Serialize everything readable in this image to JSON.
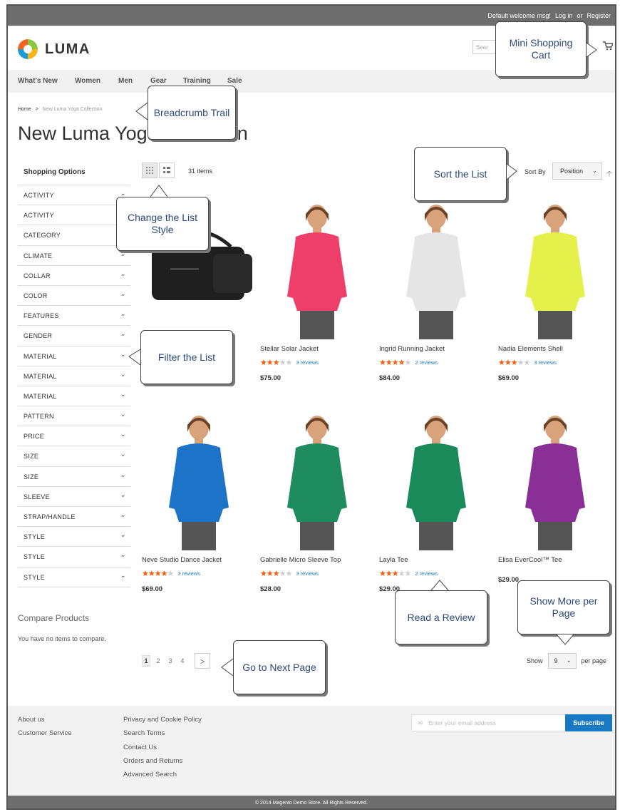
{
  "topbar": {
    "welcome": "Default welcome msg!",
    "login": "Log in",
    "or": "or",
    "register": "Register"
  },
  "header": {
    "logo_text": "LUMA",
    "search_placeholder": "Sear",
    "cart_icon": "cart-icon"
  },
  "nav": [
    "What's New",
    "Women",
    "Men",
    "Gear",
    "Training",
    "Sale"
  ],
  "breadcrumb": {
    "home": "Home",
    "separator": ">",
    "current": "New Luma Yoga Collection"
  },
  "page_title": "New Luma Yoga Collection",
  "sidebar": {
    "title": "Shopping Options",
    "filters": [
      "ACTIVITY",
      "ACTIVITY",
      "CATEGORY",
      "CLIMATE",
      "COLLAR",
      "COLOR",
      "FEATURES",
      "GENDER",
      "MATERIAL",
      "MATERIAL",
      "MATERIAL",
      "PATTERN",
      "PRICE",
      "SIZE",
      "SIZE",
      "SLEEVE",
      "STRAP/HANDLE",
      "STYLE",
      "STYLE",
      "STYLE"
    ]
  },
  "compare": {
    "title": "Compare Products",
    "text": "You have no items to compare."
  },
  "toolbar": {
    "item_count": "31 items",
    "sort_label": "Sort By",
    "sort_value": "Position"
  },
  "products": [
    {
      "name": "",
      "rating": 0,
      "reviews": "",
      "price": "",
      "color": "#1f1f1f"
    },
    {
      "name": "Stellar Solar Jacket",
      "rating": 3.5,
      "reviews": "3 reviews",
      "price": "$75.00",
      "color": "#ee3f6a"
    },
    {
      "name": "Ingrid Running Jacket",
      "rating": 4.5,
      "reviews": "2 reviews",
      "price": "$84.00",
      "color": "#e5e5e5"
    },
    {
      "name": "Nadia Elements Shell",
      "rating": 3,
      "reviews": "3 reviews",
      "price": "$69.00",
      "color": "#e4f14a"
    },
    {
      "name": "Neve Studio Dance Jacket",
      "rating": 4,
      "reviews": "3 reviews",
      "price": "$69.00",
      "color": "#1c73c7"
    },
    {
      "name": "Gabrielle Micro Sleeve Top",
      "rating": 3.5,
      "reviews": "3 reviews",
      "price": "$28.00",
      "color": "#1e8c5e"
    },
    {
      "name": "Layla Tee",
      "rating": 3,
      "reviews": "2 reviews",
      "price": "$29.00",
      "color": "#1a8a5a"
    },
    {
      "name": "Elisa EverCool™ Tee",
      "rating": 0,
      "reviews": "",
      "price": "$29.00",
      "color": "#8a2f96"
    }
  ],
  "pagination": {
    "pages": [
      "1",
      "2",
      "3",
      "4"
    ],
    "current": "1",
    "next": ">"
  },
  "limiter": {
    "show": "Show",
    "value": "9",
    "per_page": "per page"
  },
  "footer": {
    "col1": [
      "About us",
      "Customer Service"
    ],
    "col2": [
      "Privacy and Cookie Policy",
      "Search Terms",
      "Contact Us",
      "Orders and Returns",
      "Advanced Search"
    ],
    "newsletter_placeholder": "Enter your email address",
    "subscribe": "Subscribe",
    "copyright": "© 2014 Magento Demo Store. All Rights Reserved."
  },
  "callouts": {
    "mini_cart": "Mini Shopping Cart",
    "breadcrumb": "Breadcrumb Trail",
    "change_list": "Change the List Style",
    "sort_list": "Sort the List",
    "filter_list": "Filter the List",
    "read_review": "Read a Review",
    "show_more": "Show More per Page",
    "next_page": "Go to Next Page"
  },
  "colors": {
    "accent": "#1979c3",
    "star": "#ff5501",
    "callout_text": "#2c4a7c",
    "topbar": "#6e6e6e"
  }
}
